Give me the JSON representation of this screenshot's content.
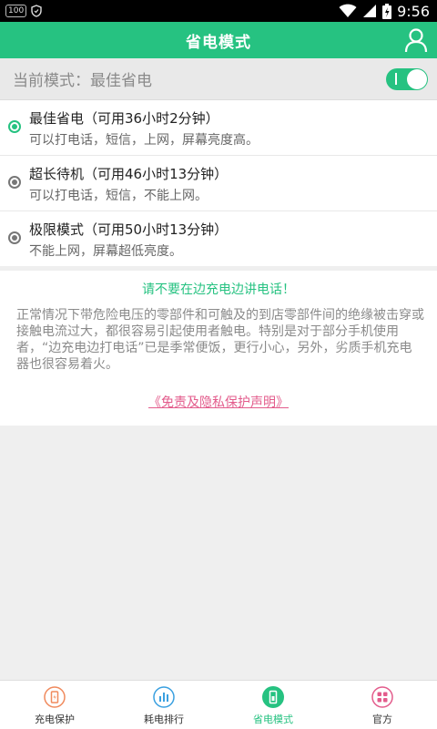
{
  "status_bar": {
    "left_chip": "100",
    "time": "9:56",
    "icons": [
      "shield-icon",
      "wifi-icon",
      "signal-icon",
      "battery-icon"
    ]
  },
  "header": {
    "title": "省电模式",
    "accent_color": "#26c281",
    "right_icon": "user-icon"
  },
  "current_mode": {
    "label": "当前模式：最佳省电",
    "toggle_on": true
  },
  "options": [
    {
      "title": "最佳省电（可用36小时2分钟）",
      "desc": "可以打电话，短信，上网，屏幕亮度高。",
      "selected": true
    },
    {
      "title": "超长待机（可用46小时13分钟）",
      "desc": "可以打电话，短信，不能上网。",
      "selected": false
    },
    {
      "title": "极限模式（可用50小时13分钟）",
      "desc": "不能上网，屏幕超低亮度。",
      "selected": false
    }
  ],
  "warning": {
    "title": "请不要在边充电边讲电话！",
    "body": "正常情况下带危险电压的零部件和可触及的到店零部件间的绝缘被击穿或接触电流过大，都很容易引起使用者触电。特别是对于部分手机使用者，“边充电边打电话”已是季常便饭，更行小心，另外，劣质手机充电器也很容易着火。",
    "link": "《免责及隐私保护声明》"
  },
  "bottom_nav": [
    {
      "label": "充电保护",
      "icon": "battery-charge-icon",
      "active": false
    },
    {
      "label": "耗电排行",
      "icon": "bar-chart-icon",
      "active": false
    },
    {
      "label": "省电模式",
      "icon": "power-save-icon",
      "active": true
    },
    {
      "label": "官方",
      "icon": "grid-apps-icon",
      "active": false
    }
  ]
}
